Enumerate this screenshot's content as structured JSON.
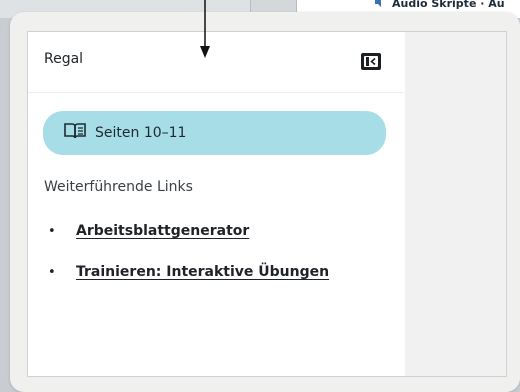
{
  "background": {
    "audio_label": "Audio Skripte · Au"
  },
  "sidebar": {
    "title": "Regal",
    "collapse_icon": "collapse-left-icon",
    "pages_button": {
      "label": "Seiten 10–11",
      "icon": "book-icon"
    },
    "links_heading": "Weiterführende Links",
    "links": [
      {
        "label": "Arbeitsblattgenerator"
      },
      {
        "label": "Trainieren: Interaktive Übungen"
      }
    ]
  },
  "colors": {
    "pill": "#a6dde6",
    "panel_bg": "#ffffff",
    "popup_bg": "#f0f0ef"
  }
}
